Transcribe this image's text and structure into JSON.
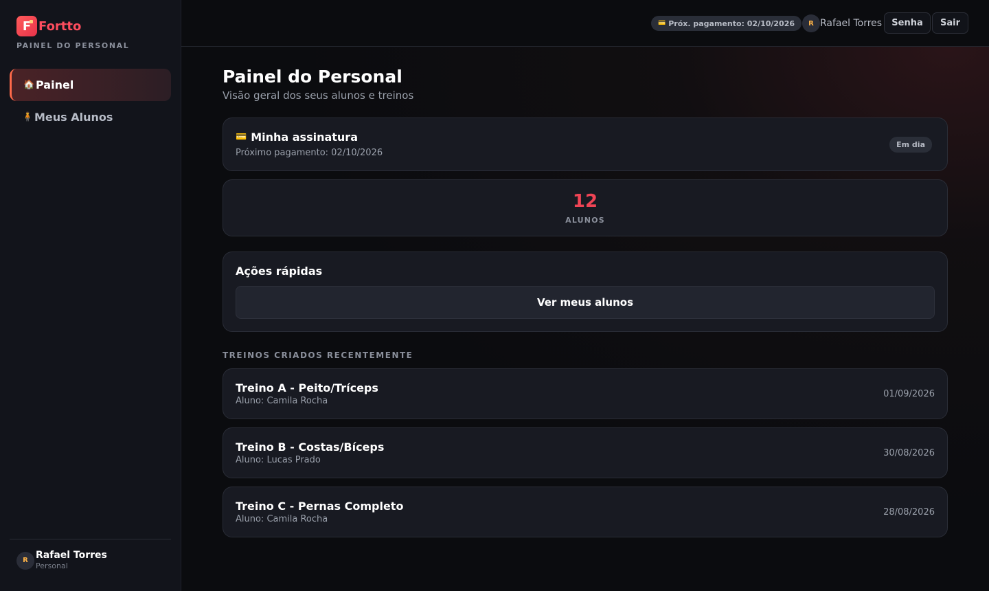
{
  "brand": {
    "letter": "F",
    "name": "Fortto",
    "subtitle": "PAINEL DO PERSONAL"
  },
  "sidebar": {
    "items": [
      {
        "icon": "🏠",
        "label": "Painel",
        "active": true
      },
      {
        "icon": "🧍",
        "label": "Meus Alunos",
        "active": false
      }
    ],
    "user": {
      "initial": "R",
      "name": "Rafael Torres",
      "role": "Personal"
    }
  },
  "topbar": {
    "payment_icon": "💳",
    "payment_text": "Próx. pagamento: 02/10/2026",
    "user_initial": "R",
    "user_name": "Rafael Torres",
    "password_button": "Senha",
    "logout_button": "Sair"
  },
  "page": {
    "title": "Painel do Personal",
    "subtitle": "Visão geral dos seus alunos e treinos"
  },
  "subscription": {
    "icon": "💳",
    "title": "Minha assinatura",
    "next_payment": "Próximo pagamento: 02/10/2026",
    "status": "Em dia"
  },
  "stats": {
    "students_count": "12",
    "students_label": "ALUNOS"
  },
  "quick_actions": {
    "title": "Ações rápidas",
    "view_students": "Ver meus alunos"
  },
  "recent": {
    "label": "TREINOS CRIADOS RECENTEMENTE",
    "workouts": [
      {
        "name": "Treino A - Peito/Tríceps",
        "student": "Aluno: Camila Rocha",
        "date": "01/09/2026"
      },
      {
        "name": "Treino B - Costas/Bíceps",
        "student": "Aluno: Lucas Prado",
        "date": "30/08/2026"
      },
      {
        "name": "Treino C - Pernas Completo",
        "student": "Aluno: Camila Rocha",
        "date": "28/08/2026"
      }
    ]
  },
  "colors": {
    "accent": "#ef4455",
    "brand_gradient_start": "#ff5b5b",
    "active_border": "#ff6a4a"
  }
}
